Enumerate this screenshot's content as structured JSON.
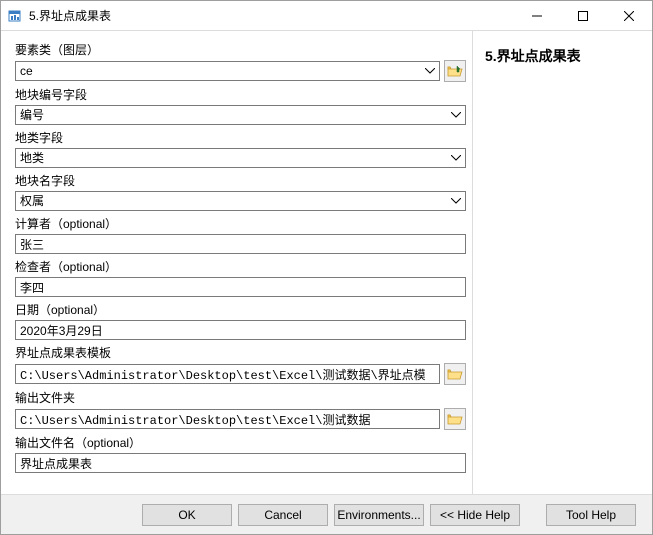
{
  "window": {
    "title": "5.界址点成果表"
  },
  "help": {
    "title": "5.界址点成果表"
  },
  "fields": {
    "feature_class": {
      "label": "要素类（图层）",
      "value": "ce"
    },
    "parcel_number_field": {
      "label": "地块编号字段",
      "value": "编号"
    },
    "land_type_field": {
      "label": "地类字段",
      "value": "地类"
    },
    "parcel_name_field": {
      "label": "地块名字段",
      "value": "权属"
    },
    "calculator": {
      "label": "计算者（optional）",
      "value": "张三"
    },
    "checker": {
      "label": "检查者（optional）",
      "value": "李四"
    },
    "date": {
      "label": "日期（optional）",
      "value": "2020年3月29日"
    },
    "template": {
      "label": "界址点成果表模板",
      "value": "C:\\Users\\Administrator\\Desktop\\test\\Excel\\测试数据\\界址点模"
    },
    "output_folder": {
      "label": "输出文件夹",
      "value": "C:\\Users\\Administrator\\Desktop\\test\\Excel\\测试数据"
    },
    "output_filename": {
      "label": "输出文件名（optional）",
      "value": "界址点成果表"
    }
  },
  "buttons": {
    "ok": "OK",
    "cancel": "Cancel",
    "environments": "Environments...",
    "hide_help": "<< Hide Help",
    "tool_help": "Tool Help"
  }
}
